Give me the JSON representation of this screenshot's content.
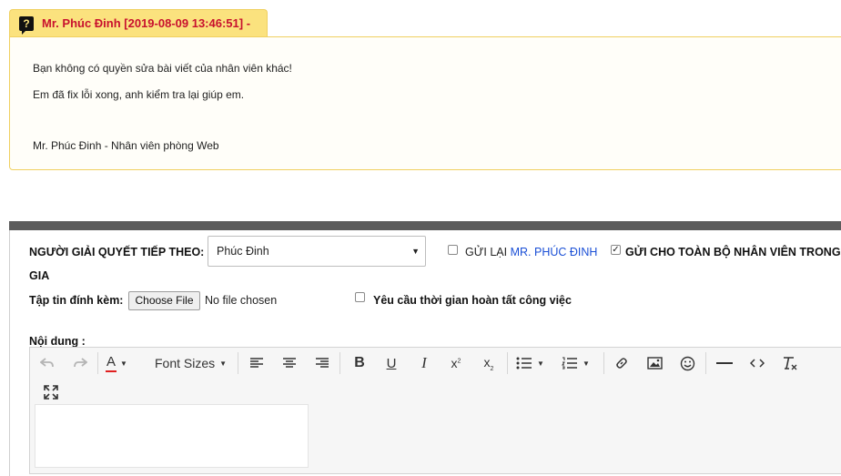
{
  "comment": {
    "title": "Mr. Phúc Đinh [2019-08-09 13:46:51] -",
    "lines": [
      "Bạn không có quyền sửa bài viết của nhân viên khác!",
      "Em đã fix lỗi xong, anh kiểm tra lại giúp em.",
      "Mr. Phúc Đinh - Nhân viên phòng Web"
    ]
  },
  "form": {
    "next_handler_label": "NGƯỜI GIẢI QUYẾT TIẾP THEO:",
    "next_handler_value": "Phúc Đinh",
    "resend_label": "GỬI LẠI",
    "resend_name": "MR. PHÚC ĐINH",
    "send_all_label": "GỬI CHO TOÀN BỘ NHÂN VIÊN TRONG",
    "send_all_label_cont": "GIA",
    "attachment_label": "Tập tin đính kèm:",
    "choose_file_label": "Choose File",
    "no_file_text": "No file chosen",
    "deadline_label": "Yêu cầu thời gian hoàn tất công việc",
    "content_label": "Nội dung :",
    "checkboxes": {
      "resend": false,
      "send_all": true,
      "deadline": false
    }
  },
  "toolbar": {
    "text_color_glyph": "A",
    "font_sizes_label": "Font Sizes",
    "text_color": "#e02020"
  }
}
